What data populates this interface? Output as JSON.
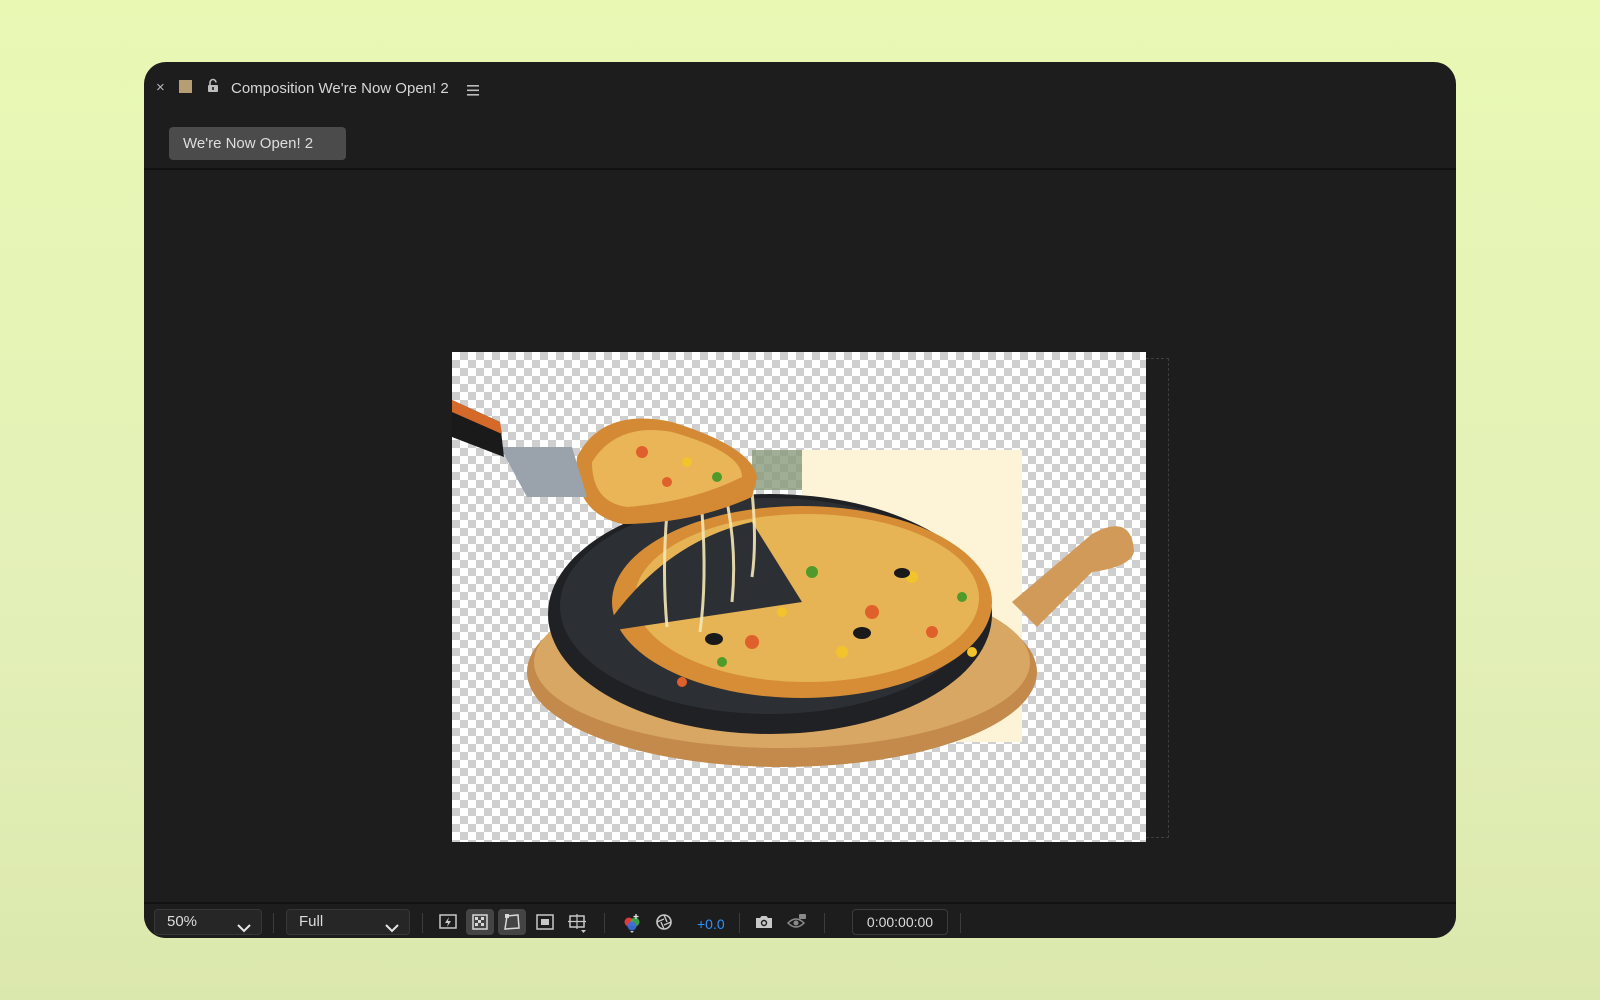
{
  "panel": {
    "close_label": "×",
    "title": "Composition We're Now Open! 2",
    "tab_label": "We're Now Open! 2",
    "label_color": "#b79d74"
  },
  "viewer": {
    "background": "transparency-checkerboard",
    "content": "pizza-layers"
  },
  "bottombar": {
    "magnification": "50%",
    "resolution": "Full",
    "exposure": "+0.0",
    "exposure_color": "#2f8fff",
    "timecode": "0:00:00:00",
    "toggles": [
      {
        "icon": "fast-previews-icon",
        "active": false
      },
      {
        "icon": "transparency-grid-icon",
        "active": true
      },
      {
        "icon": "mask-path-visibility-icon",
        "active": true
      },
      {
        "icon": "region-of-interest-icon",
        "active": false
      },
      {
        "icon": "grid-guides-icon",
        "active": false
      }
    ]
  }
}
